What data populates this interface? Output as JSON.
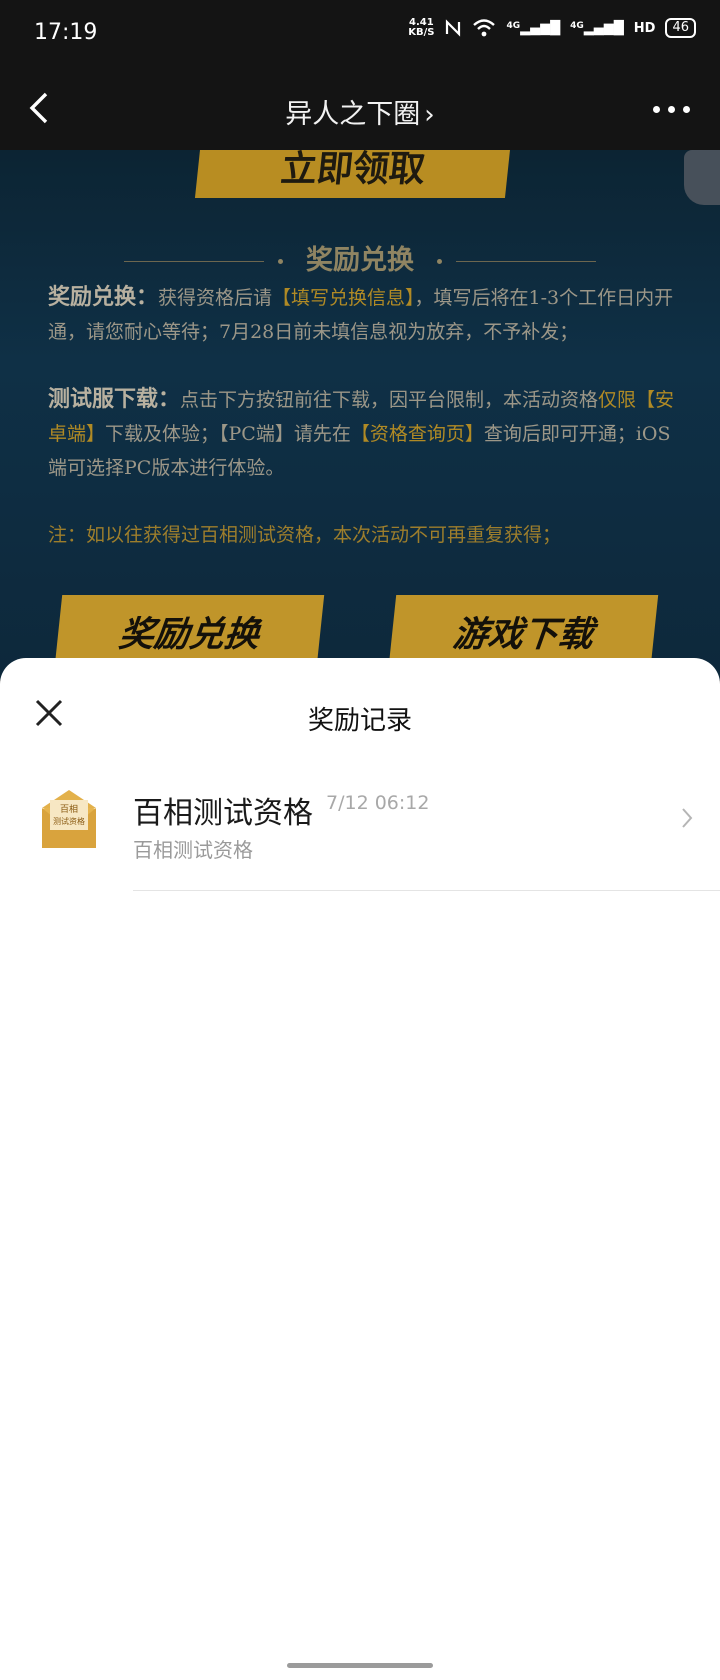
{
  "status_bar": {
    "time": "17:19",
    "net_speed_value": "4.41",
    "net_speed_unit": "KB/S",
    "signal_1": "4G",
    "signal_2": "4G",
    "hd_label": "HD",
    "battery": "46"
  },
  "nav": {
    "title": "异人之下圈",
    "title_chevron": "›"
  },
  "banner": {
    "claim_button": "立即领取",
    "section_title": "奖励兑换",
    "reward_label": "奖励兑换：",
    "reward_text_1": "获得资格后请",
    "reward_link": "【填写兑换信息】",
    "reward_text_2": "，填写后将在1-3个工作日内开通，请您耐心等待；7月28日前未填信息视为放弃，不予补发；",
    "download_label": "测试服下载：",
    "download_text_1": "点击下方按钮前往下载，因平台限制，本活动资格",
    "download_highlight": "仅限【安卓端】",
    "download_text_2": "下载及体验；【PC端】请先在",
    "download_link": "【资格查询页】",
    "download_text_3": "查询后即可开通；iOS端可选择PC版本进行体验。",
    "note": "注：如以往获得过百相测试资格，本次活动不可再重复获得；",
    "redeem_button": "奖励兑换",
    "download_button": "游戏下载"
  },
  "sheet": {
    "title": "奖励记录",
    "records": [
      {
        "name": "百相测试资格",
        "time": "7/12 06:12",
        "subtitle": "百相测试资格",
        "icon_text_1": "百相",
        "icon_text_2": "测试资格"
      }
    ]
  },
  "colors": {
    "gold": "#c0952a",
    "banner_bg": "#0f3046",
    "nav_bg": "#141414"
  }
}
